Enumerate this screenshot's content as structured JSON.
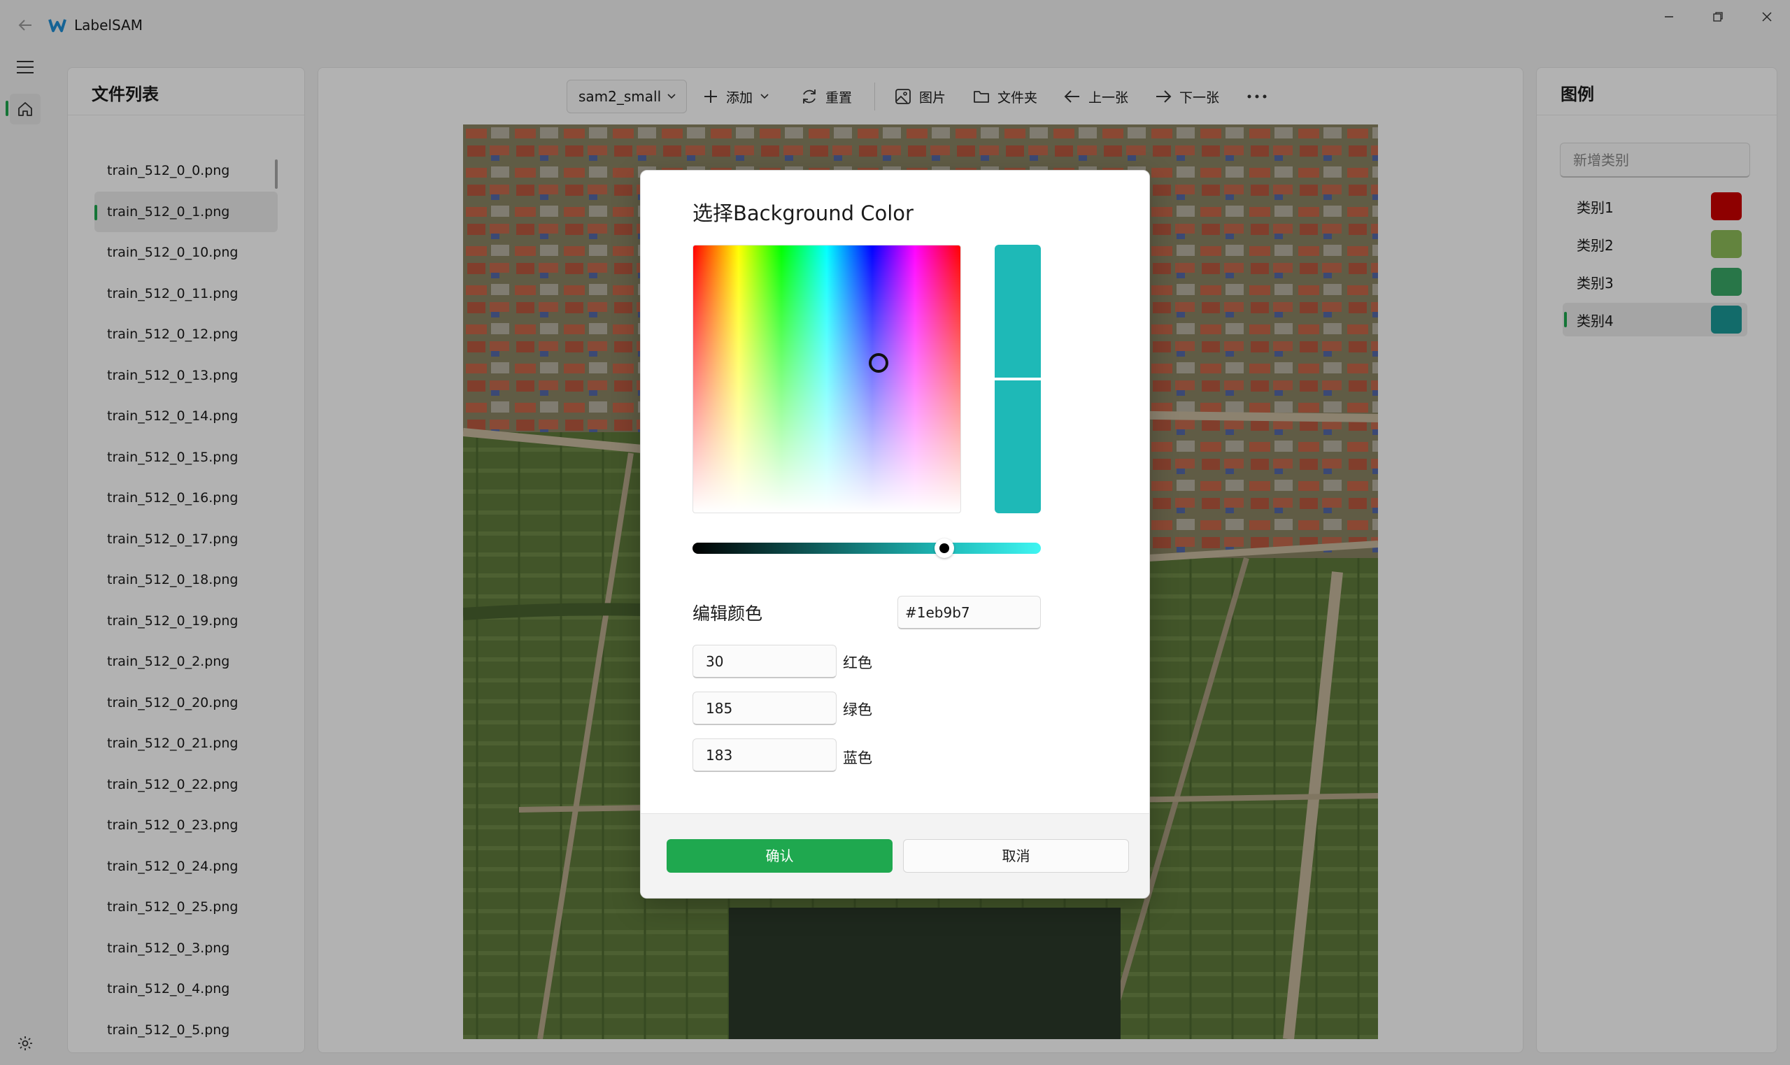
{
  "app": {
    "title": "LabelSAM",
    "logo_icon": "labelsam-logo-icon",
    "accent_color": "#1fa84f"
  },
  "nav": {
    "menu_icon": "hamburger-menu-icon",
    "home_icon": "home-icon",
    "settings_icon": "gear-icon"
  },
  "file_panel": {
    "title": "文件列表",
    "files": [
      "train_512_0_0.png",
      "train_512_0_1.png",
      "train_512_0_10.png",
      "train_512_0_11.png",
      "train_512_0_12.png",
      "train_512_0_13.png",
      "train_512_0_14.png",
      "train_512_0_15.png",
      "train_512_0_16.png",
      "train_512_0_17.png",
      "train_512_0_18.png",
      "train_512_0_19.png",
      "train_512_0_2.png",
      "train_512_0_20.png",
      "train_512_0_21.png",
      "train_512_0_22.png",
      "train_512_0_23.png",
      "train_512_0_24.png",
      "train_512_0_25.png",
      "train_512_0_3.png",
      "train_512_0_4.png",
      "train_512_0_5.png"
    ],
    "selected_file": "train_512_0_1.png"
  },
  "toolbar": {
    "model": "sam2_small",
    "add_label": "添加",
    "reset_label": "重置",
    "image_label": "图片",
    "folder_label": "文件夹",
    "prev_label": "上一张",
    "next_label": "下一张",
    "more_icon": "more-horizontal-icon"
  },
  "legend_panel": {
    "title": "图例",
    "new_class_placeholder": "新增类别",
    "classes": [
      {
        "name": "类别1",
        "color": "#cc0000"
      },
      {
        "name": "类别2",
        "color": "#8fbd5a"
      },
      {
        "name": "类别3",
        "color": "#3aa968"
      },
      {
        "name": "类别4",
        "color": "#1a9a98"
      }
    ],
    "selected_class": "类别4"
  },
  "color_dialog": {
    "title": "选择Background Color",
    "edit_label": "编辑颜色",
    "hex_prefix": "#",
    "hex_value": "1eb9b7",
    "red_value": "30",
    "red_label": "红色",
    "green_value": "185",
    "green_label": "绿色",
    "blue_value": "183",
    "blue_label": "蓝色",
    "selected_color": "#1eb9b7",
    "confirm_label": "确认",
    "cancel_label": "取消"
  }
}
